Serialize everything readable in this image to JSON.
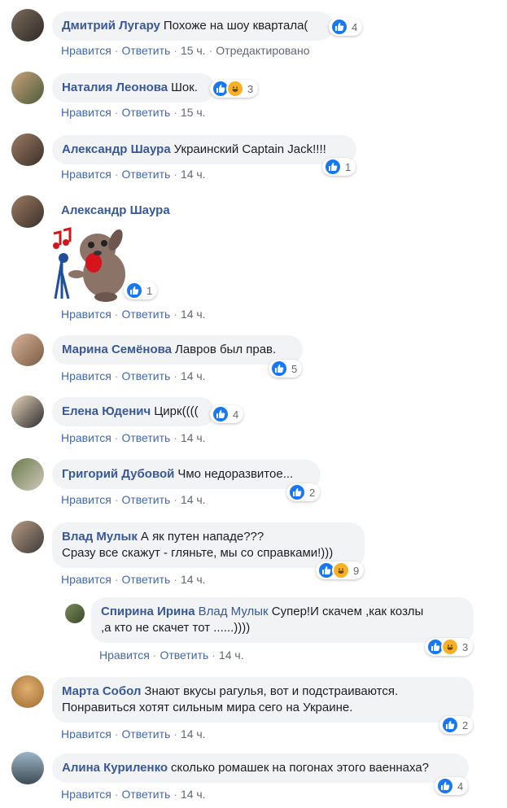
{
  "colors": {
    "link": "#385898",
    "bubble": "#f2f3f5",
    "like": "#1877f2",
    "haha": "#f7b125"
  },
  "comments": [
    {
      "name": "Дмитрий Лугару",
      "text": "Похоже на шоу квартала(",
      "reactions": [
        "like-icon"
      ],
      "count": "4",
      "like": "Нравится",
      "reply": "Ответить",
      "time": "15 ч.",
      "edited": "Отредактировано"
    },
    {
      "name": "Наталия Леонова",
      "text": "Шок.",
      "reactions": [
        "like-icon",
        "haha-icon"
      ],
      "count": "3",
      "like": "Нравится",
      "reply": "Ответить",
      "time": "15 ч."
    },
    {
      "name": "Александр Шаура",
      "text": "Украинский Captain Jack!!!!",
      "reactions": [
        "like-icon"
      ],
      "count": "1",
      "like": "Нравится",
      "reply": "Ответить",
      "time": "14 ч."
    },
    {
      "name": "Александр Шаура",
      "text": "",
      "sticker": "singing-dog-sticker",
      "reactions": [
        "like-icon"
      ],
      "count": "1",
      "like": "Нравится",
      "reply": "Ответить",
      "time": "14 ч."
    },
    {
      "name": "Марина Семёнова",
      "text": "Лавров был прав.",
      "reactions": [
        "like-icon"
      ],
      "count": "5",
      "like": "Нравится",
      "reply": "Ответить",
      "time": "14 ч."
    },
    {
      "name": "Елена Юденич",
      "text": "Цирк((((",
      "reactions": [
        "like-icon"
      ],
      "count": "4",
      "like": "Нравится",
      "reply": "Ответить",
      "time": "14 ч."
    },
    {
      "name": "Григорий Дубовой",
      "text": "Чмо недоразвитое...",
      "reactions": [
        "like-icon"
      ],
      "count": "2",
      "like": "Нравится",
      "reply": "Ответить",
      "time": "14 ч."
    },
    {
      "name": "Влад Мулык",
      "text": "А як путен нападе???",
      "text2": "Сразу все скажут - гляньте, мы со справками!)))",
      "reactions": [
        "like-icon",
        "haha-icon"
      ],
      "count": "9",
      "like": "Нравится",
      "reply": "Ответить",
      "time": "14 ч."
    },
    {
      "name": "Спирина Ирина",
      "mention": "Влад Мулык",
      "text": "Супер!И скачем ,как козлы",
      "text2": ",а кто не скачет тот ......))))",
      "reactions": [
        "like-icon",
        "haha-icon"
      ],
      "count": "3",
      "like": "Нравится",
      "reply": "Ответить",
      "time": "14 ч."
    },
    {
      "name": "Марта Собол",
      "text": "Знают вкусы рагулья, вот и подстраиваются.",
      "text2": "Понравиться хотят сильным мира сего на Украине.",
      "reactions": [
        "like-icon"
      ],
      "count": "2",
      "like": "Нравится",
      "reply": "Ответить",
      "time": "14 ч."
    },
    {
      "name": "Алина Куриленко",
      "text": "сколько ромашек на погонах этого ваеннаха?",
      "reactions": [
        "like-icon"
      ],
      "count": "4",
      "like": "Нравится",
      "reply": "Ответить",
      "time": "14 ч."
    }
  ]
}
